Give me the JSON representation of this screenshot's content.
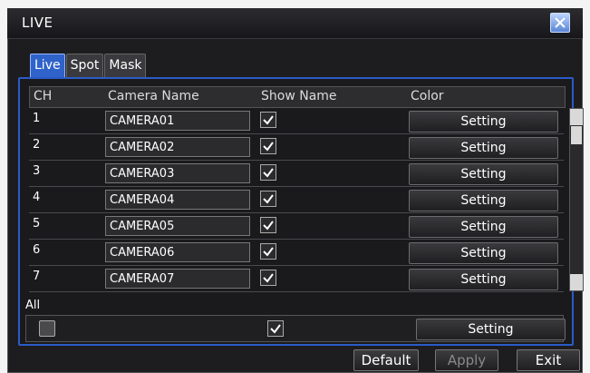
{
  "window": {
    "title": "LIVE"
  },
  "tabs": [
    {
      "label": "Live",
      "active": true
    },
    {
      "label": "Spot"
    },
    {
      "label": "Mask"
    }
  ],
  "table": {
    "headers": [
      "CH",
      "Camera Name",
      "Show Name",
      "Color"
    ],
    "rows": [
      {
        "ch": "1",
        "name": "CAMERA01",
        "show": true,
        "button": "Setting"
      },
      {
        "ch": "2",
        "name": "CAMERA02",
        "show": true,
        "button": "Setting"
      },
      {
        "ch": "3",
        "name": "CAMERA03",
        "show": true,
        "button": "Setting"
      },
      {
        "ch": "4",
        "name": "CAMERA04",
        "show": true,
        "button": "Setting"
      },
      {
        "ch": "5",
        "name": "CAMERA05",
        "show": true,
        "button": "Setting"
      },
      {
        "ch": "6",
        "name": "CAMERA06",
        "show": true,
        "button": "Setting"
      },
      {
        "ch": "7",
        "name": "CAMERA07",
        "show": true,
        "button": "Setting"
      }
    ]
  },
  "all": {
    "label": "All",
    "button": "Setting"
  },
  "footer": {
    "default": "Default",
    "apply": "Apply",
    "exit": "Exit"
  },
  "colors": {
    "accent": "#2b5bc8",
    "bg": "#1d1d1f"
  }
}
